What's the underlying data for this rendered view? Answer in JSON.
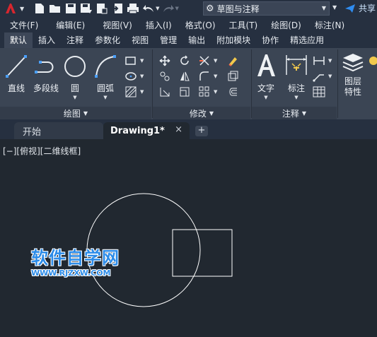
{
  "quick_access": {
    "icons": [
      "new-file-icon",
      "open-folder-icon",
      "save-icon",
      "save-as-icon",
      "open-from-web-icon",
      "save-to-web-icon",
      "plot-icon",
      "undo-icon",
      "redo-icon"
    ],
    "workspace_value": "草图与注释",
    "share_label": "共享"
  },
  "menu": {
    "items": [
      "文件(F)",
      "编辑(E)",
      "视图(V)",
      "插入(I)",
      "格式(O)",
      "工具(T)",
      "绘图(D)",
      "标注(N)"
    ]
  },
  "ribbon_tabs": {
    "items": [
      "默认",
      "插入",
      "注释",
      "参数化",
      "视图",
      "管理",
      "输出",
      "附加模块",
      "协作",
      "精选应用"
    ],
    "active": "默认"
  },
  "ribbon": {
    "draw": {
      "line": "直线",
      "polyline": "多段线",
      "circle": "圆",
      "arc": "圆弧",
      "panel_label": "绘图"
    },
    "modify": {
      "panel_label": "修改"
    },
    "annotation": {
      "text": "文字",
      "dimension": "标注",
      "panel_label": "注释"
    },
    "layers": {
      "layer_properties": "图层\n特性"
    }
  },
  "file_tabs": {
    "start": "开始",
    "drawing": "Drawing1*",
    "close_glyph": "×",
    "add_glyph": "+"
  },
  "canvas": {
    "viewport_label": "[−][俯视][二维线框]"
  },
  "watermark": {
    "title": "软件自学网",
    "url": "WWW.RJZXW.COM"
  },
  "colors": {
    "background": "#212830",
    "ribbon": "#3b4554",
    "accent_blue": "#2b8be8",
    "logo_red": "#d7262e"
  }
}
